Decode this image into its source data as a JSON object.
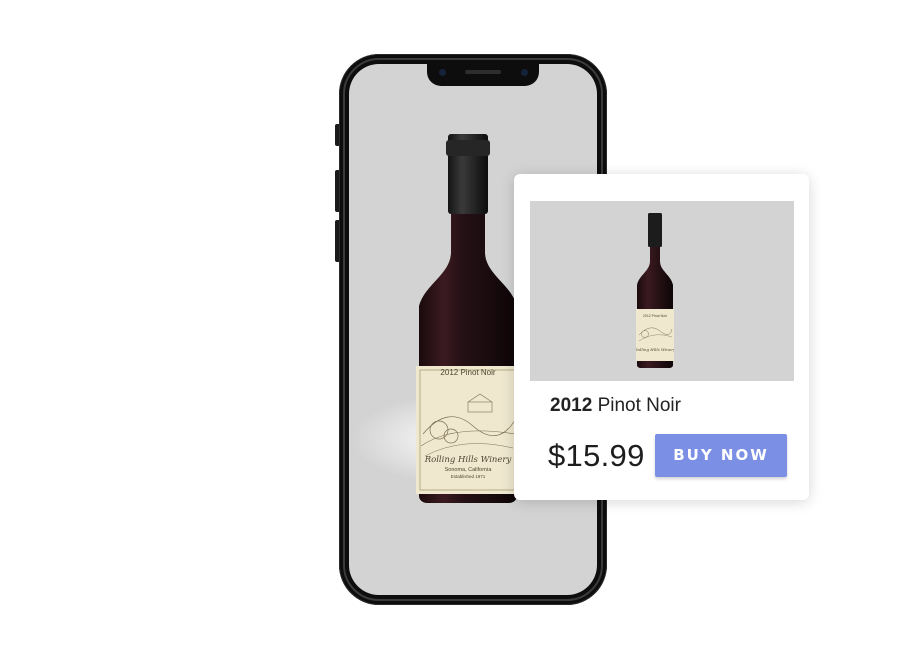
{
  "label": {
    "vintage": "2012 Pinot Noir",
    "winery": "Rolling Hills Winery",
    "location": "Sonoma, California",
    "established": "Established 1971"
  },
  "product": {
    "year": "2012",
    "name": "Pinot Noir",
    "price": "$15.99",
    "buy_label": "BUY NOW"
  },
  "colors": {
    "accent": "#7b8fe4",
    "screen_bg": "#d3d3d3",
    "bottle": "#1f0f13",
    "label_paper": "#efe8cf"
  }
}
